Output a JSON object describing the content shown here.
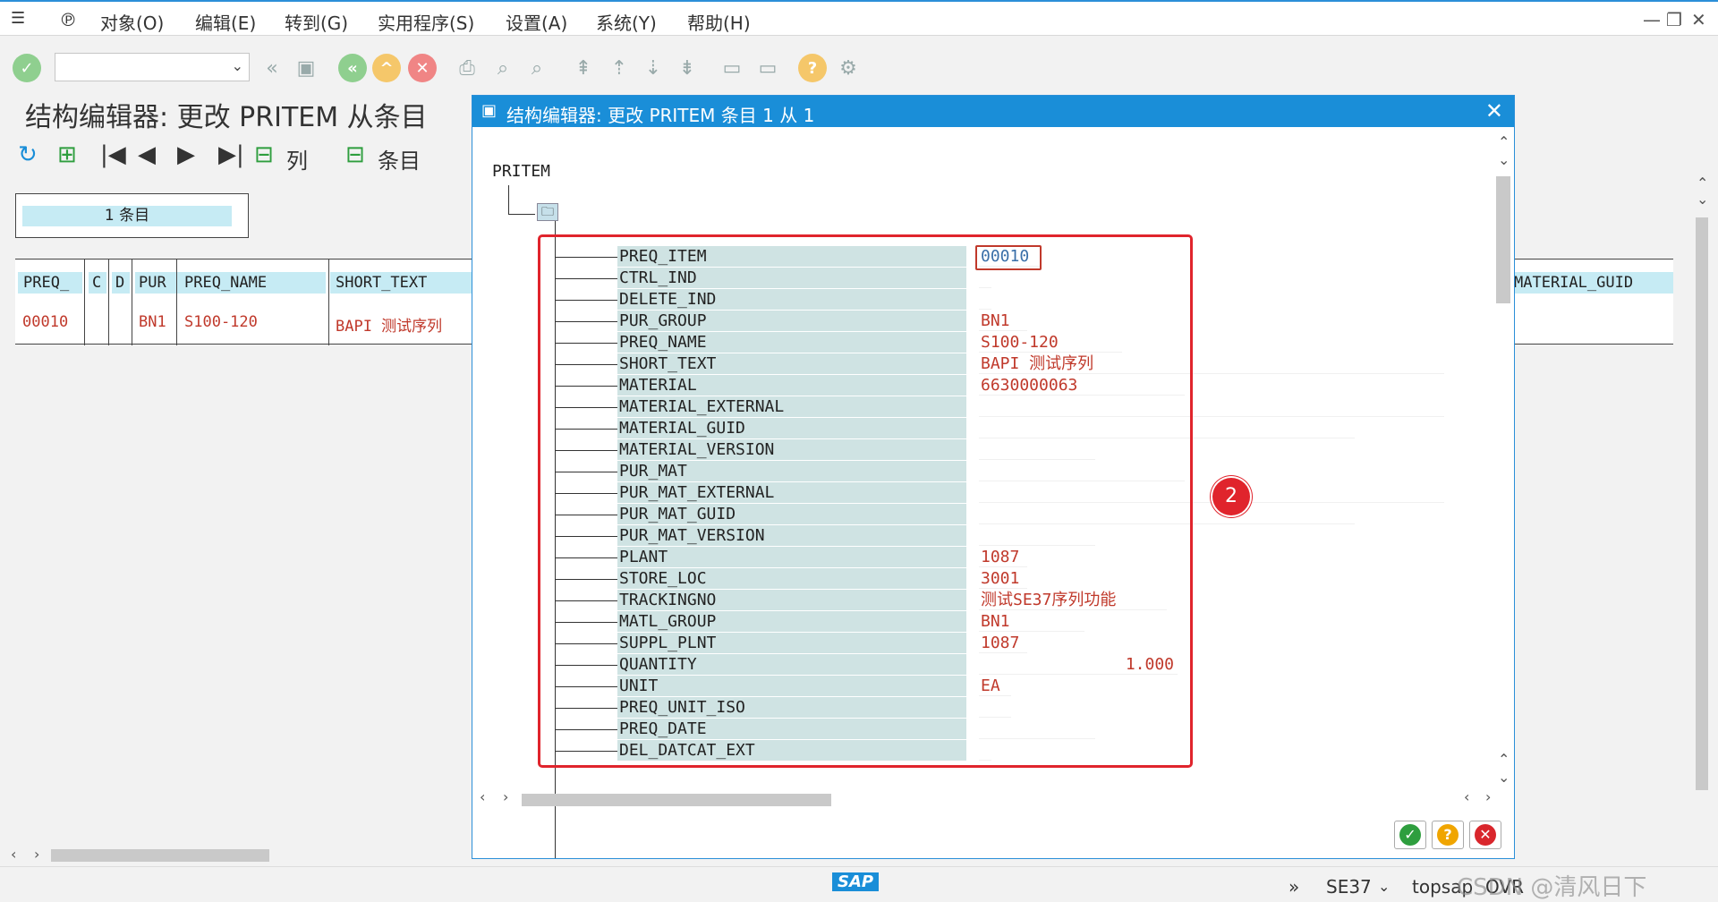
{
  "menu": {
    "items": [
      "对象(O)",
      "编辑(E)",
      "转到(G)",
      "实用程序(S)",
      "设置(A)",
      "系统(Y)",
      "帮助(H)"
    ]
  },
  "screen": {
    "title": "结构编辑器: 更改 PRITEM 从条目",
    "app_toolbar": {
      "columns_label": "列",
      "entries_label": "条目"
    },
    "entries_count": "1 条目",
    "table": {
      "headers": [
        "PREQ_",
        "C",
        "D",
        "PUR",
        "PREQ_NAME",
        "SHORT_TEXT"
      ],
      "row": [
        "00010",
        "",
        "",
        "BN1",
        "S100-120",
        "BAPI 测试序列"
      ],
      "right_header": "MATERIAL_GUID"
    }
  },
  "dialog": {
    "title": "结构编辑器: 更改 PRITEM 条目 1 从 1",
    "root": "PRITEM",
    "badge": "2",
    "fields": [
      {
        "name": "PREQ_ITEM",
        "value": "00010"
      },
      {
        "name": "CTRL_IND",
        "value": ""
      },
      {
        "name": "DELETE_IND",
        "value": ""
      },
      {
        "name": "PUR_GROUP",
        "value": "BN1"
      },
      {
        "name": "PREQ_NAME",
        "value": "S100-120"
      },
      {
        "name": "SHORT_TEXT",
        "value": "BAPI 测试序列"
      },
      {
        "name": "MATERIAL",
        "value": "6630000063"
      },
      {
        "name": "MATERIAL_EXTERNAL",
        "value": ""
      },
      {
        "name": "MATERIAL_GUID",
        "value": ""
      },
      {
        "name": "MATERIAL_VERSION",
        "value": ""
      },
      {
        "name": "PUR_MAT",
        "value": ""
      },
      {
        "name": "PUR_MAT_EXTERNAL",
        "value": ""
      },
      {
        "name": "PUR_MAT_GUID",
        "value": ""
      },
      {
        "name": "PUR_MAT_VERSION",
        "value": ""
      },
      {
        "name": "PLANT",
        "value": "1087"
      },
      {
        "name": "STORE_LOC",
        "value": "3001"
      },
      {
        "name": "TRACKINGNO",
        "value": "测试SE37序列功能"
      },
      {
        "name": "MATL_GROUP",
        "value": "BN1"
      },
      {
        "name": "SUPPL_PLNT",
        "value": "1087"
      },
      {
        "name": "QUANTITY",
        "value": "1.000"
      },
      {
        "name": "UNIT",
        "value": "EA"
      },
      {
        "name": "PREQ_UNIT_ISO",
        "value": ""
      },
      {
        "name": "PREQ_DATE",
        "value": ""
      },
      {
        "name": "DEL_DATCAT_EXT",
        "value": ""
      }
    ]
  },
  "status": {
    "logo": "SAP",
    "transaction": "SE37",
    "server": "topsap",
    "mode": "OVR",
    "watermark": "CSDN @清风日下"
  },
  "colors": {
    "accent": "#1a8ed8",
    "highlight": "#e0242c",
    "value_text": "#c0392b",
    "field_bg": "#cfe3e3"
  }
}
